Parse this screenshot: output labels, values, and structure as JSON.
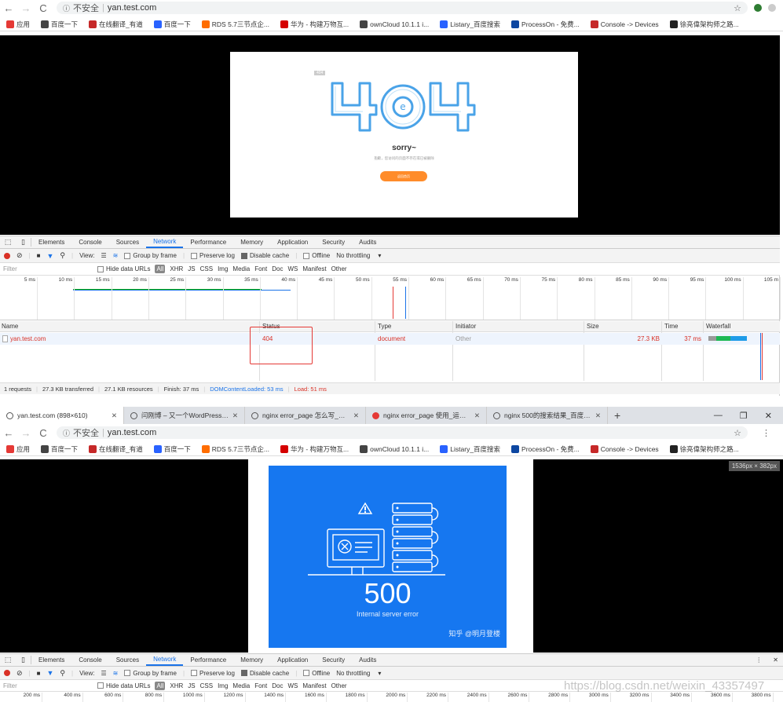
{
  "top": {
    "url_security": "不安全",
    "url": "yan.test.com",
    "bookmarks": [
      {
        "label": "应用",
        "color": "#e53935"
      },
      {
        "label": "百度一下",
        "color": "#444"
      },
      {
        "label": "在线翻译_有道",
        "color": "#c62828"
      },
      {
        "label": "百度一下",
        "color": "#2962ff"
      },
      {
        "label": "RDS 5.7三节点企...",
        "color": "#ff6d00"
      },
      {
        "label": "华为 - 构建万物互...",
        "color": "#d50000"
      },
      {
        "label": "ownCloud 10.1.1 i...",
        "color": "#444"
      },
      {
        "label": "Listary_百度搜索",
        "color": "#2962ff"
      },
      {
        "label": "ProcessOn - 免费...",
        "color": "#0d47a1"
      },
      {
        "label": "Console -> Devices",
        "color": "#c62828"
      },
      {
        "label": "徐亮偉架构师之路...",
        "color": "#222"
      }
    ],
    "page404": {
      "badge": "404",
      "sorry": "sorry~",
      "message": "抱歉，您访问的页面不存在或已被删除",
      "button": "返回首页"
    },
    "devtools": {
      "tabs": [
        "Elements",
        "Console",
        "Sources",
        "Network",
        "Performance",
        "Memory",
        "Application",
        "Security",
        "Audits"
      ],
      "active_tab": "Network",
      "toolbar": {
        "view": "View:",
        "group_by_frame": "Group by frame",
        "preserve_log": "Preserve log",
        "disable_cache": "Disable cache",
        "offline": "Offline",
        "throttling": "No throttling"
      },
      "filter": {
        "placeholder": "Filter",
        "hide_data_urls": "Hide data URLs",
        "types": [
          "All",
          "XHR",
          "JS",
          "CSS",
          "Img",
          "Media",
          "Font",
          "Doc",
          "WS",
          "Manifest",
          "Other"
        ]
      },
      "timeline_ticks": [
        "5 ms",
        "10 ms",
        "15 ms",
        "20 ms",
        "25 ms",
        "30 ms",
        "35 ms",
        "40 ms",
        "45 ms",
        "50 ms",
        "55 ms",
        "60 ms",
        "65 ms",
        "70 ms",
        "75 ms",
        "80 ms",
        "85 ms",
        "90 ms",
        "95 ms",
        "100 ms",
        "105 m"
      ],
      "columns": [
        "Name",
        "Status",
        "Type",
        "Initiator",
        "Size",
        "Time",
        "Waterfall"
      ],
      "rows": [
        {
          "name": "yan.test.com",
          "status": "404",
          "type": "document",
          "initiator": "Other",
          "size": "27.3 KB",
          "time": "37 ms"
        }
      ],
      "summary": {
        "requests": "1 requests",
        "transferred": "27.3 KB transferred",
        "resources": "27.1 KB resources",
        "finish": "Finish: 37 ms",
        "dom": "DOMContentLoaded: 53 ms",
        "load": "Load: 51 ms"
      }
    }
  },
  "bottom": {
    "tabs": [
      {
        "label": "yan.test.com (898×610)"
      },
      {
        "label": "闫刚博 – 又一个WordPress站点"
      },
      {
        "label": "nginx error_page 怎么写_百度..."
      },
      {
        "label": "nginx error_page 使用_运维_z..."
      },
      {
        "label": "nginx 500的搜索结果_百度图片..."
      }
    ],
    "url_security": "不安全",
    "url": "yan.test.com",
    "dimension_badge": "1536px × 382px",
    "page500": {
      "code": "500",
      "text": "Internal server error",
      "watermark": "知乎 @明月登楼"
    },
    "devtools": {
      "tabs": [
        "Elements",
        "Console",
        "Sources",
        "Network",
        "Performance",
        "Memory",
        "Application",
        "Security",
        "Audits"
      ],
      "active_tab": "Network",
      "timeline_ticks": [
        "200 ms",
        "400 ms",
        "600 ms",
        "800 ms",
        "1000 ms",
        "1200 ms",
        "1400 ms",
        "1600 ms",
        "1800 ms",
        "2000 ms",
        "2200 ms",
        "2400 ms",
        "2600 ms",
        "2800 ms",
        "3000 ms",
        "3200 ms",
        "3400 ms",
        "3600 ms",
        "3800 ms"
      ]
    },
    "csdn_watermark": "https://blog.csdn.net/weixin_43357497"
  }
}
